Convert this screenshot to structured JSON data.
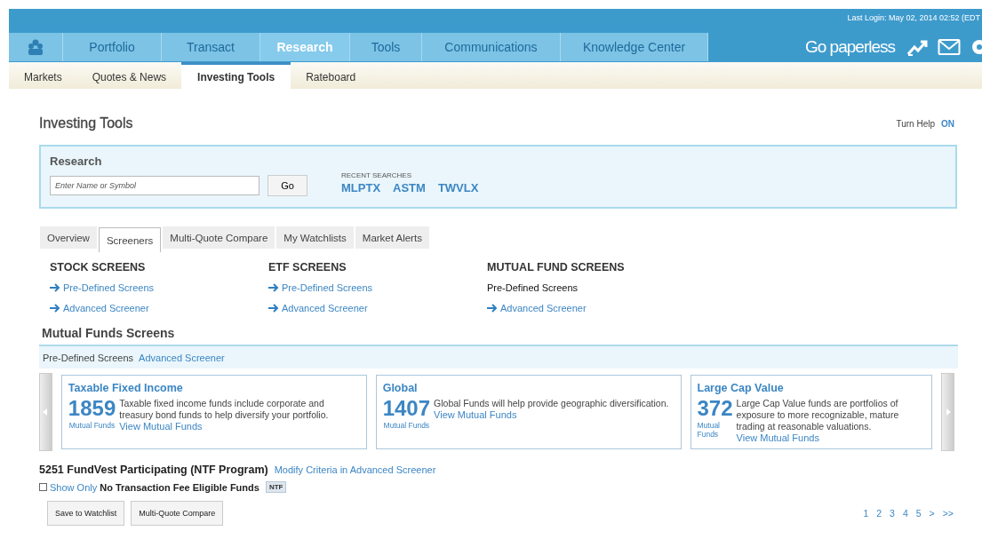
{
  "header": {
    "last_login": "Last Login: May 02, 2014 02:52 (EDT",
    "promo": "Go paperless"
  },
  "nav_tabs": [
    {
      "label": "Portfolio",
      "selected": false
    },
    {
      "label": "Transact",
      "selected": false
    },
    {
      "label": "Research",
      "selected": true
    },
    {
      "label": "Tools",
      "selected": false
    },
    {
      "label": "Communications",
      "selected": false
    },
    {
      "label": "Knowledge Center",
      "selected": false
    }
  ],
  "sub_tabs": [
    {
      "label": "Markets",
      "selected": false
    },
    {
      "label": "Quotes & News",
      "selected": false
    },
    {
      "label": "Investing Tools",
      "selected": true
    },
    {
      "label": "Rateboard",
      "selected": false
    }
  ],
  "page_title": "Investing Tools",
  "help": {
    "label": "Turn Help",
    "state": "ON"
  },
  "research": {
    "title": "Research",
    "placeholder": "Enter Name or Symbol",
    "button": "Go",
    "recent_label": "RECENT SEARCHES",
    "recent": [
      "MLPTX",
      "ASTM",
      "TWVLX"
    ]
  },
  "tool_tabs": [
    {
      "label": "Overview",
      "selected": false
    },
    {
      "label": "Screeners",
      "selected": true
    },
    {
      "label": "Multi-Quote Compare",
      "selected": false
    },
    {
      "label": "My Watchlists",
      "selected": false
    },
    {
      "label": "Market Alerts",
      "selected": false
    }
  ],
  "screen_groups": [
    {
      "title": "STOCK SCREENS",
      "links": [
        {
          "label": "Pre-Defined Screens",
          "selected": false
        },
        {
          "label": "Advanced Screener",
          "selected": false
        }
      ]
    },
    {
      "title": "ETF SCREENS",
      "links": [
        {
          "label": "Pre-Defined Screens",
          "selected": false
        },
        {
          "label": "Advanced Screener",
          "selected": false
        }
      ]
    },
    {
      "title": "MUTUAL FUND SCREENS",
      "links": [
        {
          "label": "Pre-Defined Screens",
          "selected": true
        },
        {
          "label": "Advanced Screener",
          "selected": false
        }
      ]
    }
  ],
  "mf_section": {
    "title": "Mutual Funds Screens",
    "modes": [
      {
        "label": "Pre-Defined Screens",
        "selected": true
      },
      {
        "label": "Advanced Screener",
        "selected": false
      }
    ]
  },
  "cards": [
    {
      "title": "Taxable Fixed Income",
      "count": "1859",
      "count_label": "Mutual Funds",
      "description": "Taxable fixed income funds include corporate and treasury bond funds to help diversify your portfolio.",
      "link": "View Mutual Funds"
    },
    {
      "title": "Global",
      "count": "1407",
      "count_label": "Mutual Funds",
      "description": "Global Funds will help provide geographic diversification.",
      "link": "View Mutual Funds"
    },
    {
      "title": "Large Cap Value",
      "count": "372",
      "count_label": "Mutual Funds",
      "description": "Large Cap Value funds are portfolios of exposure to more recognizable, mature trading at reasonable valuations.",
      "link": "View Mutual Funds"
    }
  ],
  "results": {
    "summary": "5251 FundVest Participating (NTF Program)",
    "modify_link": "Modify Criteria in Advanced Screener",
    "filter_prefix": "Show Only",
    "filter_label": "No Transaction Fee Eligible Funds",
    "filter_checked": false,
    "badge": "NTF"
  },
  "actions": [
    "Save to Watchlist",
    "Multi-Quote Compare"
  ],
  "pagination": [
    "1",
    "2",
    "3",
    "4",
    "5",
    ">",
    ">>"
  ]
}
